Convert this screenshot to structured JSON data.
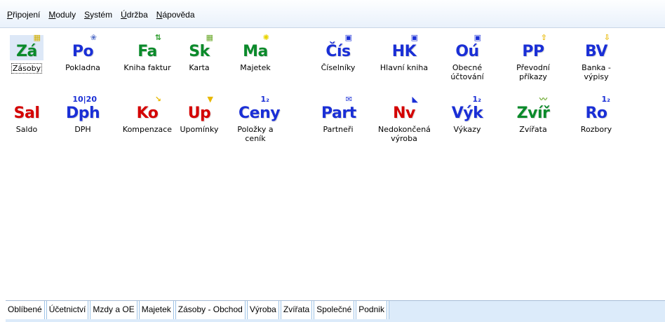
{
  "menu": [
    {
      "label": "Připojení",
      "underline": "P",
      "rest": "řipojení"
    },
    {
      "label": "Moduly",
      "underline": "M",
      "rest": "oduly"
    },
    {
      "label": "Systém",
      "underline": "S",
      "rest": "ystém"
    },
    {
      "label": "Údržba",
      "underline": "Ú",
      "rest": "držba"
    },
    {
      "label": "Nápověda",
      "underline": "N",
      "rest": "ápověda"
    }
  ],
  "modules_row1": [
    {
      "abbr": "Zá",
      "label": "Zásoby",
      "color": "#0a8a2a",
      "badge": "▦",
      "badge_color": "#d6b100"
    },
    {
      "abbr": "Po",
      "label": "Pokladna",
      "color": "#1a2fd6",
      "badge": "❀",
      "badge_color": "#5570c8"
    },
    {
      "abbr": "Fa",
      "label": "Kniha faktur",
      "color": "#0a8a2a",
      "badge": "⇅",
      "badge_color": "#2a9b2a"
    },
    {
      "abbr": "Sk",
      "label": "Karta",
      "color": "#0a8a2a",
      "badge": "▦",
      "badge_color": "#6aa82a"
    },
    {
      "abbr": "Ma",
      "label": "Majetek",
      "color": "#0a8a2a",
      "badge": "✺",
      "badge_color": "#e8d400"
    },
    {
      "abbr": "Čís",
      "label": "Číselníky",
      "color": "#1a2fd6",
      "badge": "▣",
      "badge_color": "#1a2fd6"
    },
    {
      "abbr": "HK",
      "label": "Hlavní kniha",
      "color": "#1a2fd6",
      "badge": "▣",
      "badge_color": "#1a2fd6"
    },
    {
      "abbr": "Oú",
      "label": "Obecné\núčtování",
      "color": "#1a2fd6",
      "badge": "▣",
      "badge_color": "#1a2fd6"
    },
    {
      "abbr": "PP",
      "label": "Převodní\npříkazy",
      "color": "#1a2fd6",
      "badge": "⇧",
      "badge_color": "#e8b800"
    },
    {
      "abbr": "BV",
      "label": "Banka - výpisy",
      "color": "#1a2fd6",
      "badge": "⇩",
      "badge_color": "#e8b800"
    }
  ],
  "modules_row2": [
    {
      "abbr": "Sal",
      "label": "Saldo",
      "color": "#d40000",
      "badge": "",
      "badge_color": "#000000"
    },
    {
      "abbr": "Dph",
      "label": "DPH",
      "color": "#1a2fd6",
      "badge": "10|20",
      "badge_color": "#1a2fd6"
    },
    {
      "abbr": "Ko",
      "label": "Kompenzace",
      "color": "#d40000",
      "badge": "↘",
      "badge_color": "#e8b800"
    },
    {
      "abbr": "Up",
      "label": "Upomínky",
      "color": "#d40000",
      "badge": "▼",
      "badge_color": "#e8b800"
    },
    {
      "abbr": "Ceny",
      "label": "Položky a\nceník",
      "color": "#1a2fd6",
      "badge": "1₂",
      "badge_color": "#1a2fd6"
    },
    {
      "abbr": "Part",
      "label": "Partneři",
      "color": "#1a2fd6",
      "badge": "✉",
      "badge_color": "#1a2fd6"
    },
    {
      "abbr": "Nv",
      "label": "Nedokončená\nvýroba",
      "color": "#d40000",
      "badge": "◣",
      "badge_color": "#1a2fd6"
    },
    {
      "abbr": "Výk",
      "label": "Výkazy",
      "color": "#1a2fd6",
      "badge": "1₂",
      "badge_color": "#1a2fd6"
    },
    {
      "abbr": "Zvíř",
      "label": "Zvířata",
      "color": "#0a8a2a",
      "badge": "〰",
      "badge_color": "#6aa82a"
    },
    {
      "abbr": "Ro",
      "label": "Rozbory",
      "color": "#1a2fd6",
      "badge": "1₂",
      "badge_color": "#1a2fd6"
    }
  ],
  "tabs": [
    "Oblíbené",
    "Účetnictví",
    "Mzdy a OE",
    "Majetek",
    "Zásoby - Obchod",
    "Výroba",
    "Zvířata",
    "Společné",
    "Podnik"
  ]
}
